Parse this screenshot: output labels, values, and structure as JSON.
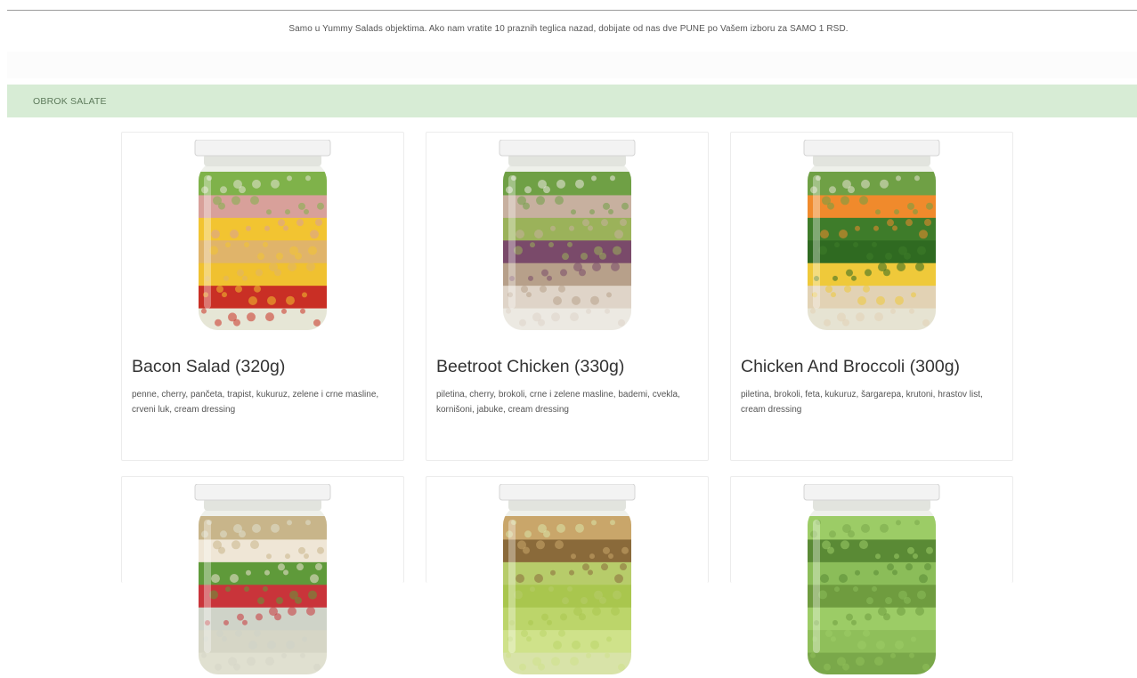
{
  "notice": {
    "text": "Samo u Yummy Salads objektima. Ako nam vratite 10 praznih teglica nazad, dobijate od nas dve PUNE po Vašem izboru za SAMO 1 RSD."
  },
  "category": {
    "title": "OBROK SALATE"
  },
  "products": [
    {
      "name": "Bacon Salad (320g)",
      "description": "penne, cherry, pančeta, trapist, kukuruz, zelene i crne masline, crveni luk, cream dressing",
      "image_icon": "salad-jar-image",
      "layers": [
        "#e6e6d6",
        "#c92f25",
        "#f0c130",
        "#e0b46a",
        "#f2c431",
        "#d8a09a",
        "#7fb24a"
      ]
    },
    {
      "name": "Beetroot Chicken (330g)",
      "description": "piletina, cherry, brokoli, crne i zelene masline, bademi, cvekla, kornišoni, jabuke, cream dressing",
      "image_icon": "salad-jar-image",
      "layers": [
        "#ece9e2",
        "#dfd4c8",
        "#b7a08a",
        "#7a4a6a",
        "#9bb25a",
        "#c7b09f",
        "#6fa045"
      ]
    },
    {
      "name": "Chicken And Broccoli (300g)",
      "description": "piletina, brokoli, feta, kukuruz, šargarepa, krutoni, hrastov list, cream dressing",
      "image_icon": "salad-jar-image",
      "layers": [
        "#e6e3d2",
        "#e2d2b4",
        "#efc93a",
        "#2f6a21",
        "#3e7c2a",
        "#f08a2c",
        "#6fa045"
      ]
    },
    {
      "name": "",
      "description": "",
      "image_icon": "salad-jar-image",
      "layers": [
        "#e0e0d0",
        "#d6d6c6",
        "#cfd3c8",
        "#c9343a",
        "#5f9a3a",
        "#efe6d6",
        "#c8b58a"
      ]
    },
    {
      "name": "",
      "description": "",
      "image_icon": "salad-jar-image",
      "layers": [
        "#d8e3a8",
        "#cfe28a",
        "#bcd56a",
        "#a9c64e",
        "#b7cc6a",
        "#8a6a3a",
        "#c9a66a"
      ]
    },
    {
      "name": "",
      "description": "",
      "image_icon": "salad-jar-image",
      "layers": [
        "#7aa84a",
        "#8fbf5a",
        "#9ccc66",
        "#6f9c3f",
        "#8bbd59",
        "#5a8a35",
        "#9ccc66"
      ]
    }
  ]
}
